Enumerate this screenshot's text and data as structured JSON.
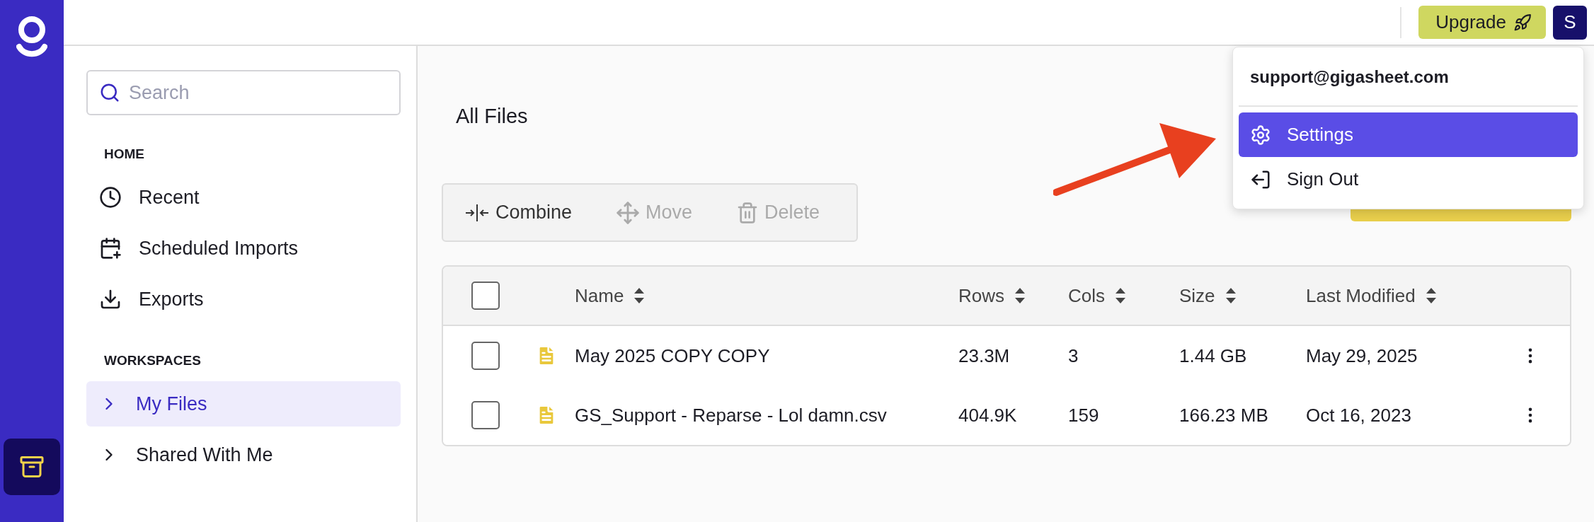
{
  "topbar": {
    "upgrade": "Upgrade",
    "avatar": "S"
  },
  "sidebar": {
    "search": {
      "placeholder": "Search"
    },
    "sections": [
      {
        "title": "HOME",
        "items": [
          {
            "label": "Recent",
            "kind": "clock",
            "selected": false
          },
          {
            "label": "Scheduled Imports",
            "kind": "calendar",
            "selected": false
          },
          {
            "label": "Exports",
            "kind": "download",
            "selected": false
          }
        ]
      },
      {
        "title": "WORKSPACES",
        "items": [
          {
            "label": "My Files",
            "kind": "chevron",
            "selected": true
          },
          {
            "label": "Shared With Me",
            "kind": "chevron",
            "selected": false
          }
        ]
      }
    ]
  },
  "page": {
    "title": "All Files"
  },
  "toolbar": [
    {
      "label": "Combine",
      "kind": "combine",
      "disabled": false
    },
    {
      "label": "Move",
      "kind": "move",
      "disabled": true
    },
    {
      "label": "Delete",
      "kind": "delete",
      "disabled": true
    }
  ],
  "table": {
    "header_checked": false,
    "columns": [
      "Name",
      "Rows",
      "Cols",
      "Size",
      "Last Modified"
    ],
    "rows": [
      {
        "checked": false,
        "cells": [
          "May 2025 COPY COPY",
          "23.3M",
          "3",
          "1.44 GB",
          "May 29, 2025"
        ]
      },
      {
        "checked": false,
        "cells": [
          "GS_Support - Reparse - Lol damn.csv",
          "404.9K",
          "159",
          "166.23 MB",
          "Oct 16, 2023"
        ]
      }
    ]
  },
  "menu": {
    "email": "support@gigasheet.com",
    "items": [
      {
        "label": "Settings",
        "kind": "settings",
        "selected": true
      },
      {
        "label": "Sign Out",
        "kind": "signout",
        "selected": false
      }
    ]
  }
}
